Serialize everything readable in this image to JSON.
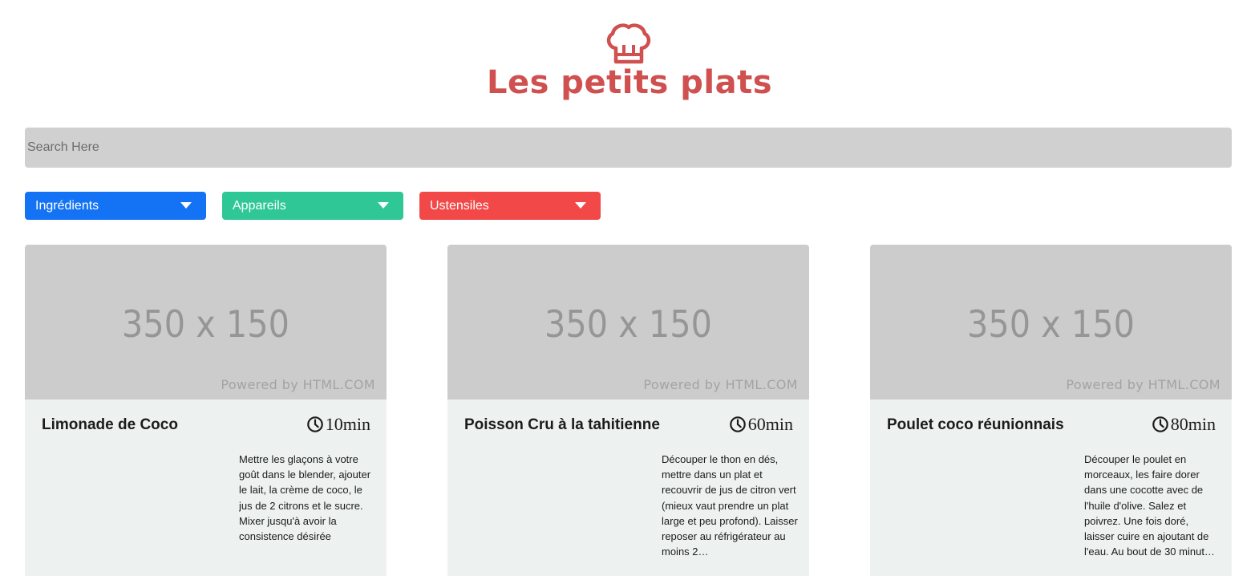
{
  "header": {
    "logo_icon": "chef-hat-icon",
    "title": "Les petits plats",
    "brand_color": "#d04f4f"
  },
  "search": {
    "placeholder": "Search Here",
    "value": ""
  },
  "filters": [
    {
      "label": "Ingrédients",
      "color": "#1473f5",
      "icon": "chevron-down-icon"
    },
    {
      "label": "Appareils",
      "color": "#2ec795",
      "icon": "chevron-down-icon"
    },
    {
      "label": "Ustensiles",
      "color": "#f24848",
      "icon": "chevron-down-icon"
    }
  ],
  "recipes": [
    {
      "image_size_label": "350 x 150",
      "image_credit": "Powered by HTML.COM",
      "title": "Limonade de Coco",
      "time_icon": "clock-icon",
      "time": "10min",
      "description": "Mettre les glaçons à votre goût dans le blender, ajouter le lait, la crème de coco, le jus de 2 citrons et le sucre. Mixer jusqu'à avoir la consistence désirée"
    },
    {
      "image_size_label": "350 x 150",
      "image_credit": "Powered by HTML.COM",
      "title": "Poisson Cru à la tahitienne",
      "time_icon": "clock-icon",
      "time": "60min",
      "description": "Découper le thon en dés, mettre dans un plat et recouvrir de jus de citron vert (mieux vaut prendre un plat large et peu profond). Laisser reposer au réfrigérateur au moins 2…"
    },
    {
      "image_size_label": "350 x 150",
      "image_credit": "Powered by HTML.COM",
      "title": "Poulet coco réunionnais",
      "time_icon": "clock-icon",
      "time": "80min",
      "description": "Découper le poulet en morceaux, les faire dorer dans une cocotte avec de l'huile d'olive. Salez et poivrez. Une fois doré, laisser cuire en ajoutant de l'eau. Au bout de 30 minut…"
    }
  ]
}
